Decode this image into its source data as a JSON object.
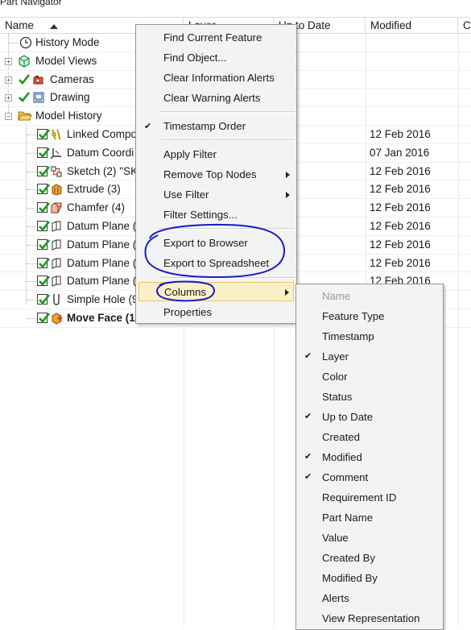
{
  "panel": {
    "title": "Part Navigator"
  },
  "columns": [
    {
      "label": "Name"
    },
    {
      "label": "Layer"
    },
    {
      "label": "Up to Date"
    },
    {
      "label": "Modified"
    },
    {
      "label": "C"
    }
  ],
  "tree": [
    {
      "label": "History Mode",
      "icon": "clock-icon",
      "modified": ""
    },
    {
      "label": "Model Views",
      "icon": "cube-views-icon",
      "modified": ""
    },
    {
      "label": "Cameras",
      "icon": "camera-icon",
      "modified": ""
    },
    {
      "label": "Drawing",
      "icon": "drawing-icon",
      "modified": ""
    },
    {
      "label": "Model History",
      "icon": "folder-open-icon",
      "modified": ""
    },
    {
      "label": "Linked Compo",
      "icon": "linked-component-icon",
      "modified": "12 Feb 2016"
    },
    {
      "label": "Datum Coordi",
      "icon": "datum-csys-icon",
      "modified": "07 Jan 2016"
    },
    {
      "label": "Sketch (2) \"SKI",
      "icon": "sketch-icon",
      "modified": "12 Feb 2016"
    },
    {
      "label": "Extrude (3)",
      "icon": "extrude-icon",
      "modified": "12 Feb 2016"
    },
    {
      "label": "Chamfer (4)",
      "icon": "chamfer-icon",
      "modified": "12 Feb 2016"
    },
    {
      "label": "Datum Plane (",
      "icon": "datum-plane-icon",
      "modified": "12 Feb 2016"
    },
    {
      "label": "Datum Plane (",
      "icon": "datum-plane-icon",
      "modified": "12 Feb 2016"
    },
    {
      "label": "Datum Plane (",
      "icon": "datum-plane-icon",
      "modified": "12 Feb 2016"
    },
    {
      "label": "Datum Plane (",
      "icon": "datum-plane-icon",
      "modified": "12 Feb 2016"
    },
    {
      "label": "Simple Hole (9",
      "icon": "hole-icon",
      "modified": ""
    },
    {
      "label": "Move Face (1",
      "icon": "move-face-icon",
      "modified": ""
    }
  ],
  "context_menu": {
    "items": [
      {
        "label": "Find Current Feature"
      },
      {
        "label": "Find Object..."
      },
      {
        "label": "Clear Information Alerts"
      },
      {
        "label": "Clear Warning Alerts"
      },
      {
        "label": "Timestamp Order",
        "checked": true
      },
      {
        "label": "Apply Filter"
      },
      {
        "label": "Remove Top Nodes",
        "submenu": true
      },
      {
        "label": "Use Filter",
        "submenu": true
      },
      {
        "label": "Filter Settings..."
      },
      {
        "label": "Export to Browser"
      },
      {
        "label": "Export to Spreadsheet"
      },
      {
        "label": "Columns",
        "submenu": true
      },
      {
        "label": "Properties"
      }
    ]
  },
  "columns_submenu": {
    "items": [
      {
        "label": "Name",
        "checked": false,
        "disabled": true
      },
      {
        "label": "Feature Type",
        "checked": false
      },
      {
        "label": "Timestamp",
        "checked": false
      },
      {
        "label": "Layer",
        "checked": true
      },
      {
        "label": "Color",
        "checked": false
      },
      {
        "label": "Status",
        "checked": false
      },
      {
        "label": "Up to Date",
        "checked": true
      },
      {
        "label": "Created",
        "checked": false
      },
      {
        "label": "Modified",
        "checked": true
      },
      {
        "label": "Comment",
        "checked": true
      },
      {
        "label": "Requirement ID",
        "checked": false
      },
      {
        "label": "Part Name",
        "checked": false
      },
      {
        "label": "Value",
        "checked": false
      },
      {
        "label": "Created By",
        "checked": false
      },
      {
        "label": "Modified By",
        "checked": false
      },
      {
        "label": "Alerts",
        "checked": false
      },
      {
        "label": "View Representation",
        "checked": false
      }
    ]
  },
  "colors": {
    "annotation": "#1a1acc",
    "highlight": "#fcf0c8",
    "checkmark": "#1a9a1a"
  }
}
